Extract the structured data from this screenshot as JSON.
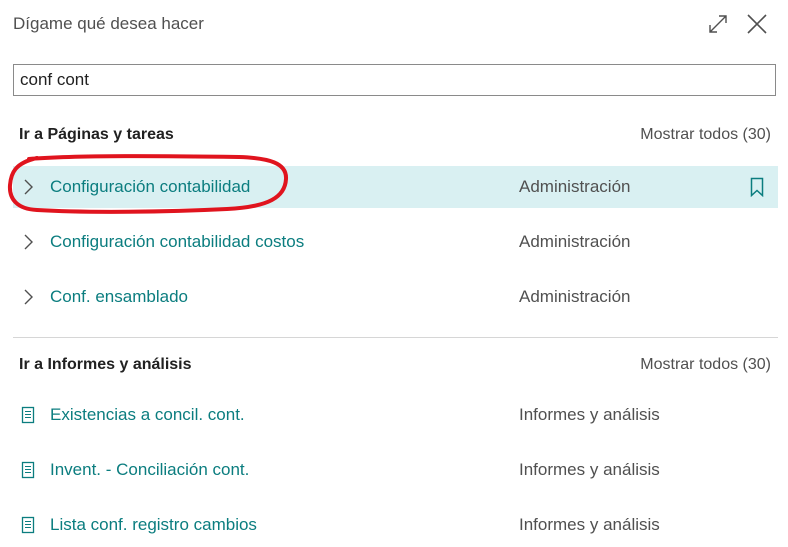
{
  "header": {
    "title": "Dígame qué desea hacer",
    "icons": {
      "expand": "expand-icon",
      "close": "close-icon"
    }
  },
  "search": {
    "value": "conf cont",
    "placeholder": ""
  },
  "sections": {
    "pages": {
      "title": "Ir a Páginas y tareas",
      "show_all": "Mostrar todos (30)",
      "items": [
        {
          "label": "Configuración contabilidad",
          "category": "Administración",
          "icon": "chevron-right-icon",
          "selected": true
        },
        {
          "label": "Configuración contabilidad costos",
          "category": "Administración",
          "icon": "chevron-right-icon"
        },
        {
          "label": "Conf. ensamblado",
          "category": "Administración",
          "icon": "chevron-right-icon"
        }
      ]
    },
    "reports": {
      "title": "Ir a Informes y análisis",
      "show_all": "Mostrar todos (30)",
      "items": [
        {
          "label": "Existencias a concil. cont.",
          "category": "Informes y análisis",
          "icon": "report-icon"
        },
        {
          "label": "Invent. - Conciliación cont.",
          "category": "Informes y análisis",
          "icon": "report-icon"
        },
        {
          "label": "Lista conf. registro cambios",
          "category": "Informes y análisis",
          "icon": "report-icon"
        }
      ]
    }
  },
  "colors": {
    "accent": "#0b7d7f",
    "selected_row": "#d9f0f2",
    "annotation": "#e0141e"
  }
}
